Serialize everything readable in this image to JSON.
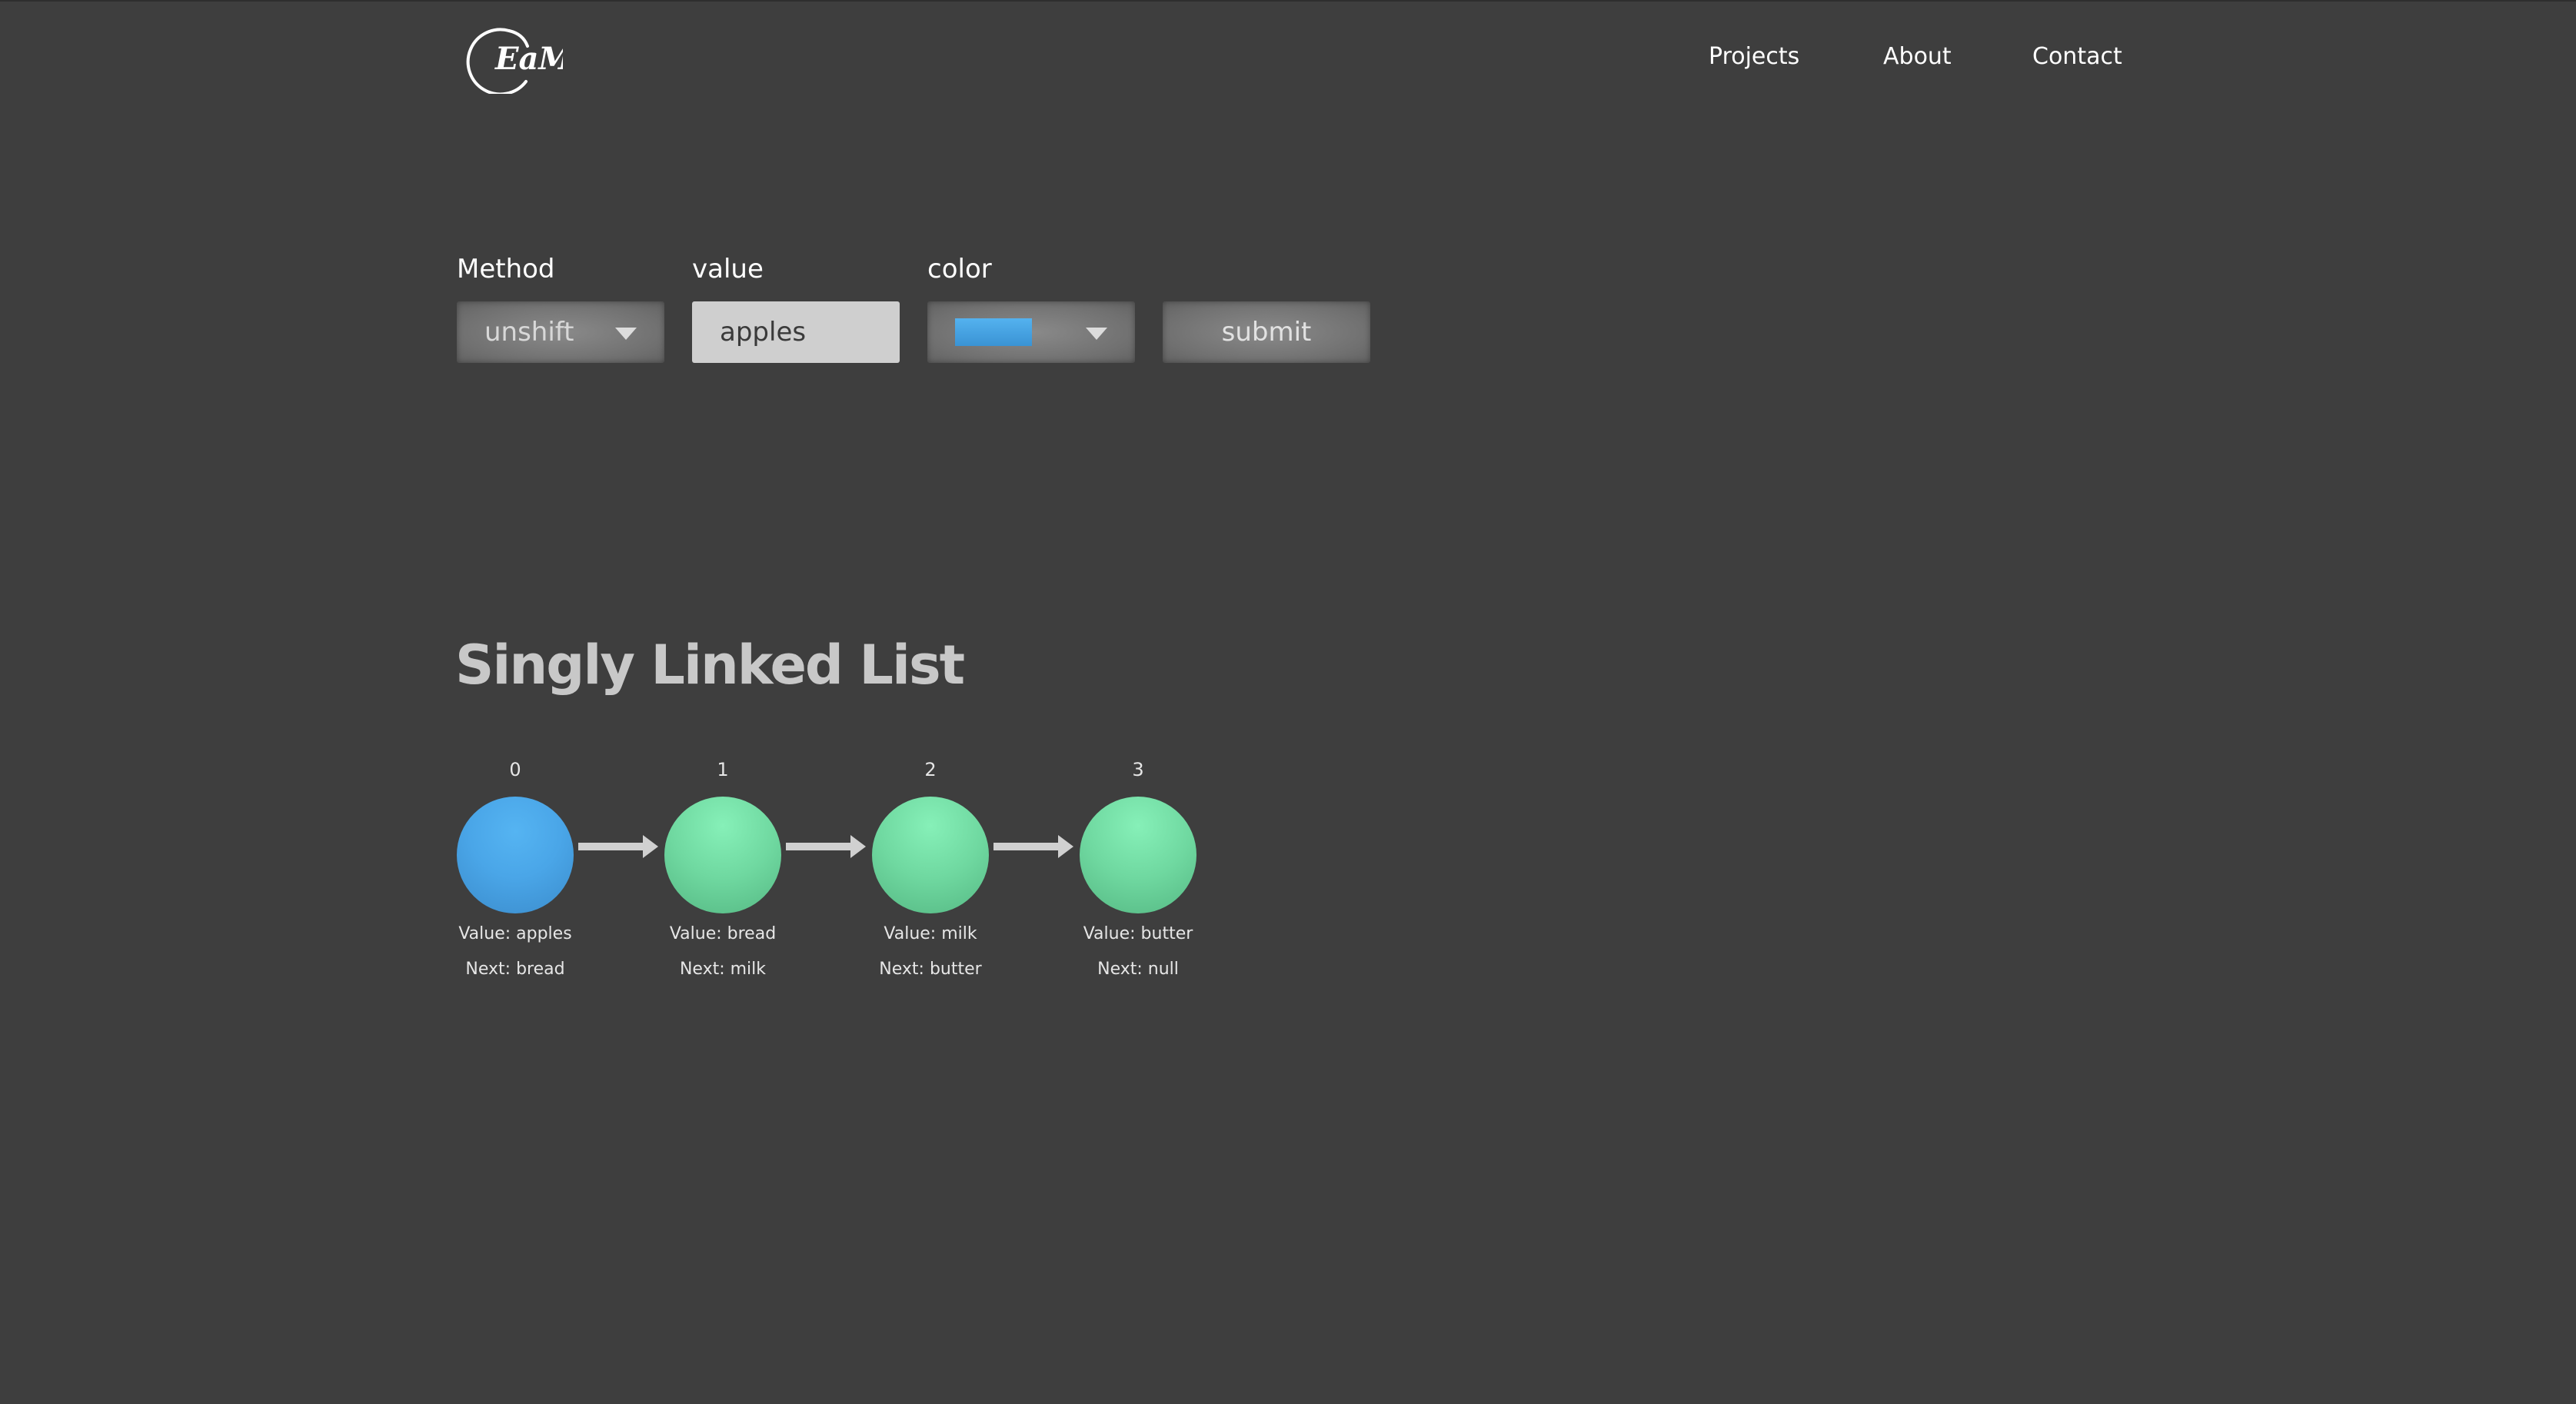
{
  "header": {
    "logo_text": "EaM",
    "nav": [
      {
        "label": "Projects"
      },
      {
        "label": "About"
      },
      {
        "label": "Contact"
      }
    ]
  },
  "form": {
    "method": {
      "label": "Method",
      "value": "unshift"
    },
    "value": {
      "label": "value",
      "value": "apples"
    },
    "color": {
      "label": "color",
      "selected_color": "#4aa6e8"
    },
    "submit_label": "submit"
  },
  "list": {
    "title": "Singly Linked List",
    "nodes": [
      {
        "index": "0",
        "value": "Value: apples",
        "next": "Next: bread",
        "color": "blue"
      },
      {
        "index": "1",
        "value": "Value: bread",
        "next": "Next: milk",
        "color": "green"
      },
      {
        "index": "2",
        "value": "Value: milk",
        "next": "Next: butter",
        "color": "green"
      },
      {
        "index": "3",
        "value": "Value: butter",
        "next": "Next: null",
        "color": "green"
      }
    ]
  },
  "colors": {
    "background": "#3e3e3e",
    "node_blue": "#4aa6e8",
    "node_green": "#6fd8a0",
    "title": "#c8c8c8"
  }
}
